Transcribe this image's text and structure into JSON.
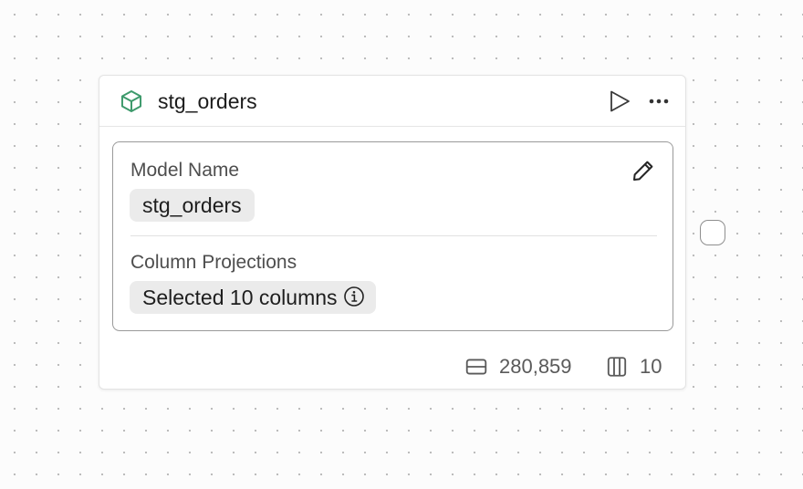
{
  "node": {
    "title": "stg_orders",
    "icon": "cube-icon",
    "accent_color": "#3e9a6c",
    "actions": {
      "run_icon": "play-icon",
      "more_icon": "more-horizontal-icon",
      "edit_icon": "pencil-icon"
    },
    "config": {
      "model_name_label": "Model Name",
      "model_name_value": "stg_orders",
      "projections_label": "Column Projections",
      "projections_value": "Selected 10 columns",
      "projections_info_icon": "info-icon"
    },
    "footer": {
      "row_count": "280,859",
      "row_icon": "rows-icon",
      "column_count": "10",
      "column_icon": "columns-icon"
    }
  },
  "canvas": {
    "output_handle": "output-connection-handle"
  }
}
